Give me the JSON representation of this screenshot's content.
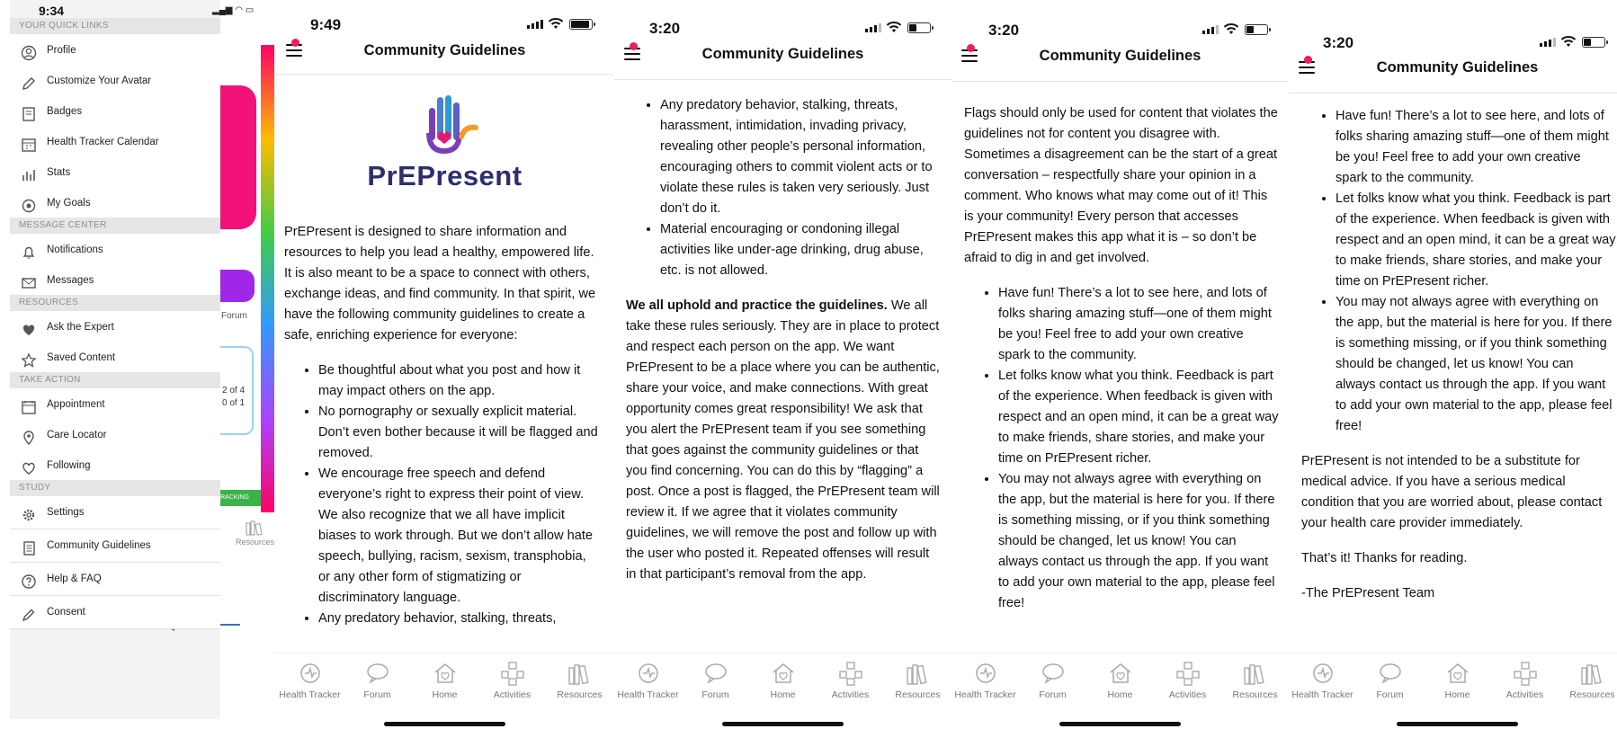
{
  "menu_screen": {
    "time": "9:34",
    "sections": [
      {
        "heading": "YOUR QUICK LINKS",
        "items": [
          "Profile",
          "Customize Your Avatar",
          "Badges",
          "Health Tracker Calendar",
          "Stats",
          "My Goals"
        ]
      },
      {
        "heading": "MESSAGE CENTER",
        "items": [
          "Notifications",
          "Messages"
        ]
      },
      {
        "heading": "RESOURCES",
        "items": [
          "Ask the Expert",
          "Saved Content"
        ]
      },
      {
        "heading": "TAKE ACTION",
        "items": [
          "Appointment",
          "Care Locator",
          "Following"
        ]
      },
      {
        "heading": "STUDY",
        "items": [
          "Settings",
          "Community Guidelines",
          "Help & FAQ",
          "Consent"
        ]
      }
    ],
    "background": {
      "forum": "Forum",
      "counter1": "2 of 4",
      "counter2": "0 of 1",
      "tracking": "RACKING",
      "resources": "Resources"
    }
  },
  "tabs": [
    "Health Tracker",
    "Forum",
    "Home",
    "Activities",
    "Resources"
  ],
  "screens": [
    {
      "time": "9:49",
      "title": "Community Guidelines",
      "logo_text": "PrEPresent",
      "intro": "PrEPresent is designed to share information and resources to help you lead a healthy, empowered life. It is also meant to be a space to connect with others, exchange ideas, and find community. In that spirit, we have the following community guidelines to create a safe, enriching experience for everyone:",
      "bullets": [
        "Be thoughtful about what you post and how it may impact others on the app.",
        "No pornography or sexually explicit material. Don’t even bother because it will be flagged and removed.",
        "We encourage free speech and defend everyone’s right to express their point of view. We also recognize that we all have implicit biases to work through. But we don’t allow hate speech, bullying, racism, sexism, transphobia, or any other form of stigmatizing or discriminatory language.",
        "Any predatory behavior, stalking, threats,"
      ]
    },
    {
      "time": "3:20",
      "title": "Community Guidelines",
      "bullets": [
        "Any predatory behavior, stalking, threats, harassment, intimidation, invading privacy, revealing other people’s personal information, encouraging others to commit violent acts or to violate these rules is taken very seriously. Just don’t do it.",
        "Material encouraging or condoning illegal activities like under-age drinking, drug abuse, etc. is not allowed."
      ],
      "bold_lead": "We all uphold and practice the guidelines.",
      "paragraph": " We all take these rules seriously. They are in place to protect and respect each person on the app. We want PrEPresent to be a place where you can be authentic, share your voice, and make connections. With great opportunity comes great responsibility! We ask that you alert the PrEPresent team if you see something that goes against the community guidelines or that you find concerning. You can do this by “flagging” a post. Once a post is flagged, the PrEPresent team will review it. If we agree that it violates community guidelines, we will remove the post and follow up with the user who posted it. Repeated offenses will result in that participant’s removal from the app."
    },
    {
      "time": "3:20",
      "title": "Community Guidelines",
      "paragraph": "Flags should only be used for content that violates the guidelines not for content you disagree with. Sometimes a disagreement can be the start of a great conversation – respectfully share your opinion in a comment. Who knows what may come out of it! This is your community! Every person that accesses PrEPresent makes this app what it is – so don’t be afraid to dig in and get involved.",
      "bullets": [
        "Have fun! There’s a lot to see here, and lots of folks sharing amazing stuff—one of them might be you! Feel free to add your own creative spark to the community.",
        "Let folks know what you think. Feedback is part of the experience. When feedback is given with respect and an open mind, it can be a great way to make friends, share stories, and make your time on PrEPresent richer.",
        "You may not always agree with everything on the app, but the material is here for you. If there is something missing, or if you think something should be changed, let us know! You can always contact us through the app. If you want to add your own material to the app, please feel free!"
      ]
    },
    {
      "time": "3:20",
      "title": "Community Guidelines",
      "bullets": [
        "Have fun! There’s a lot to see here, and lots of folks sharing amazing stuff—one of them might be you! Feel free to add your own creative spark to the community.",
        "Let folks know what you think. Feedback is part of the experience. When feedback is given with respect and an open mind, it can be a great way to make friends, share stories, and make your time on PrEPresent richer.",
        "You may not always agree with everything on the app, but the material is here for you. If there is something missing, or if you think something should be changed, let us know! You can always contact us through the app. If you want to add your own material to the app, please feel free!"
      ],
      "disclaimer": "PrEPresent is not intended to be a substitute for medical advice. If you have a serious medical condition that you are worried about, please contact your health care provider immediately.",
      "thanks": "That’s it! Thanks for reading.",
      "signoff": "-The PrEPresent Team"
    }
  ],
  "colors": {
    "accent": "#ee1d5c",
    "arrow": "#3c6fb8",
    "logo_text": "#2d2e6e",
    "pink_card": "#f2127a"
  }
}
